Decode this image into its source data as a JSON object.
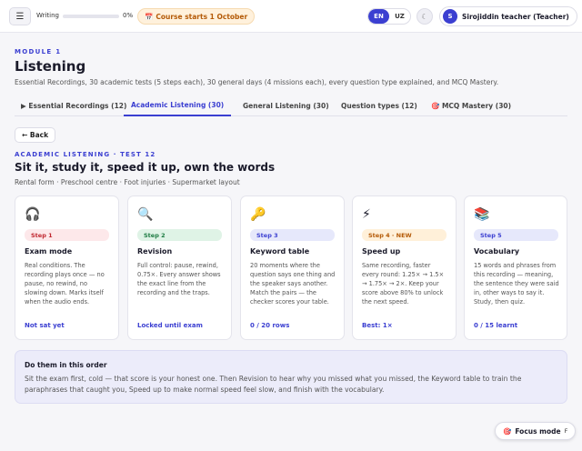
{
  "topbar": {
    "menu_icon": "☰",
    "writing_label": "Writing",
    "writing_progress": 0,
    "writing_progress_text": "0%",
    "course_icon": "📅",
    "course_badge": "Course starts 1 October",
    "languages": [
      "EN",
      "UZ"
    ],
    "active_language": "EN",
    "back_icon": "☾",
    "user_initial": "S",
    "user_name": "Sirojiddin teacher (Teacher)"
  },
  "header": {
    "module_label": "MODULE 1",
    "title": "Listening",
    "subtitle": "Essential Recordings, 30 academic tests (5 steps each), 30 general days (4 missions each), every question type explained, and MCQ Mastery."
  },
  "tabs": [
    {
      "label": "▶ Essential Recordings (12)",
      "active": false
    },
    {
      "label": "Academic Listening (30)",
      "active": true
    },
    {
      "label": "General Listening (30)",
      "active": false
    },
    {
      "label": "Question types (12)",
      "active": false
    },
    {
      "label": "🎯 MCQ Mastery (30)",
      "active": false
    }
  ],
  "back_label": "← Back",
  "test": {
    "label": "ACADEMIC LISTENING · TEST 12",
    "title": "Sit it, study it, speed it up, own the words",
    "subtitle": "Rental form · Preschool centre · Foot injuries · Supermarket layout"
  },
  "cards": [
    {
      "icon": "🎧",
      "icon_name": "headphones-icon",
      "step": "Step 1",
      "step_bg": "#fde8ea",
      "step_color": "#c0262f",
      "title": "Exam mode",
      "desc": "Real conditions. The recording plays once — no pause, no rewind, no slowing down. Marks itself when the audio ends.",
      "status": "Not sat yet"
    },
    {
      "icon": "🔍",
      "icon_name": "magnifier-icon",
      "step": "Step 2",
      "step_bg": "#dff3e6",
      "step_color": "#1e7c43",
      "title": "Revision",
      "desc": "Full control: pause, rewind, 0.75×. Every answer shows the exact line from the recording and the traps.",
      "status": "Locked until exam"
    },
    {
      "icon": "🔑",
      "icon_name": "key-icon",
      "step": "Step 3",
      "step_bg": "#e6e8fb",
      "step_color": "#3b3fd1",
      "title": "Keyword table",
      "desc": "20 moments where the question says one thing and the speaker says another. Match the pairs — the checker scores your table.",
      "status": "0 / 20 rows"
    },
    {
      "icon": "⚡",
      "icon_name": "lightning-icon",
      "step": "Step 4 · NEW",
      "step_bg": "#fff0d9",
      "step_color": "#b45a07",
      "title": "Speed up",
      "desc": "Same recording, faster every round: 1.25× → 1.5× → 1.75× → 2×. Keep your score above 80% to unlock the next speed.",
      "status": "Best: 1×"
    },
    {
      "icon": "📚",
      "icon_name": "books-icon",
      "step": "Step 5",
      "step_bg": "#e6e8fb",
      "step_color": "#3b3fd1",
      "title": "Vocabulary",
      "desc": "15 words and phrases from this recording — meaning, the sentence they were said in, other ways to say it. Study, then quiz.",
      "status": "0 / 15 learnt"
    }
  ],
  "order": {
    "title": "Do them in this order",
    "text": "Sit the exam first, cold — that score is your honest one. Then Revision to hear why you missed what you missed, the Keyword table to train the paraphrases that caught you, Speed up to make normal speed feel slow, and finish with the vocabulary."
  },
  "focus": {
    "icon": "🎯",
    "label": "Focus mode",
    "key": "F"
  },
  "colors": {
    "accent": "#3b3fd1",
    "course_badge_text": "#b45a07"
  }
}
